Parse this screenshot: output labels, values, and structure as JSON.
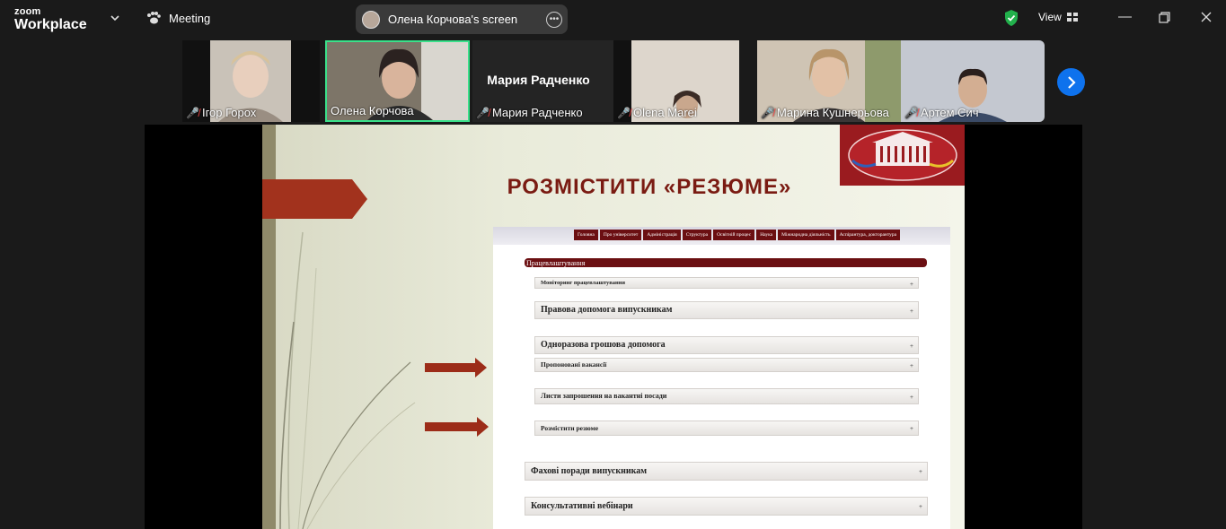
{
  "app": {
    "logo_top": "zoom",
    "logo_bottom": "Workplace",
    "meeting_label": "Meeting",
    "share_label": "Олена Корчова's screen",
    "view_label": "View"
  },
  "participants": [
    {
      "name": "Ігор Горох",
      "muted": true
    },
    {
      "name": "Олена Корчова",
      "muted": false,
      "active": true
    },
    {
      "name": "Мария Радченко",
      "muted": true,
      "display_name": "Мария Радченко"
    },
    {
      "name": "Olena Mareі",
      "muted": true
    },
    {
      "name": "Марина Кушнерьова",
      "muted": true
    },
    {
      "name": "Артем Сич",
      "muted": true
    }
  ],
  "slide": {
    "title": "РОЗМІСТИТИ «РЕЗЮМЕ»",
    "nav": [
      "Головна",
      "Про університет",
      "Адміністрація",
      "Структура",
      "Освітній процес",
      "Наука",
      "Міжнародна діяльність",
      "Аспірантура, докторантура"
    ],
    "section": "Працевлаштування",
    "items": [
      "Моніторинг працевлаштування",
      "Правова допомога випускникам",
      "Одноразова грошова допомога",
      "Пропоновані вакансії",
      "Листи запрошення на вакантні посади",
      "Розмістити резюме",
      "Фахові поради випускникам",
      "Консультативні вебінари"
    ]
  },
  "colors": {
    "accent_green": "#2ecc71",
    "zoom_blue": "#0e72ed",
    "slide_red": "#7a1b12"
  }
}
